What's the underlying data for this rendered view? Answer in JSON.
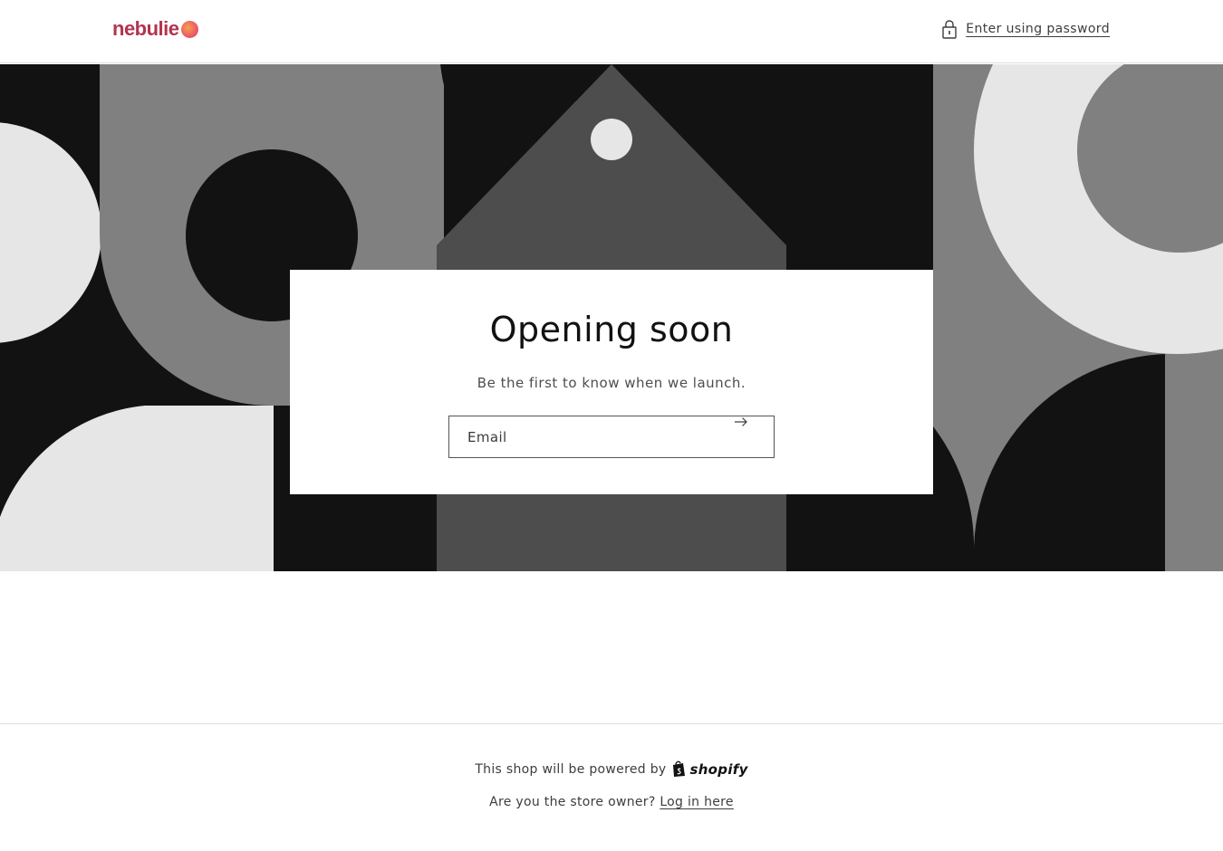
{
  "header": {
    "logo_text": "nebulie",
    "password_link_label": "Enter using password"
  },
  "newsletter": {
    "title": "Opening soon",
    "subtitle": "Be the first to know when we launch.",
    "email_placeholder": "Email"
  },
  "footer": {
    "powered_text": "This shop will be powered by",
    "shopify_label": "shopify",
    "owner_question": "Are you the store owner?",
    "login_link_label": "Log in here"
  },
  "colors": {
    "logo_brand": "#b3334f",
    "banner_dark": "#121212",
    "banner_mid": "#808080",
    "banner_light": "#e6e6e6"
  },
  "icons": {
    "lock": "lock-icon",
    "submit": "arrow-right-icon",
    "shopify_bag": "shopify-bag-icon"
  }
}
